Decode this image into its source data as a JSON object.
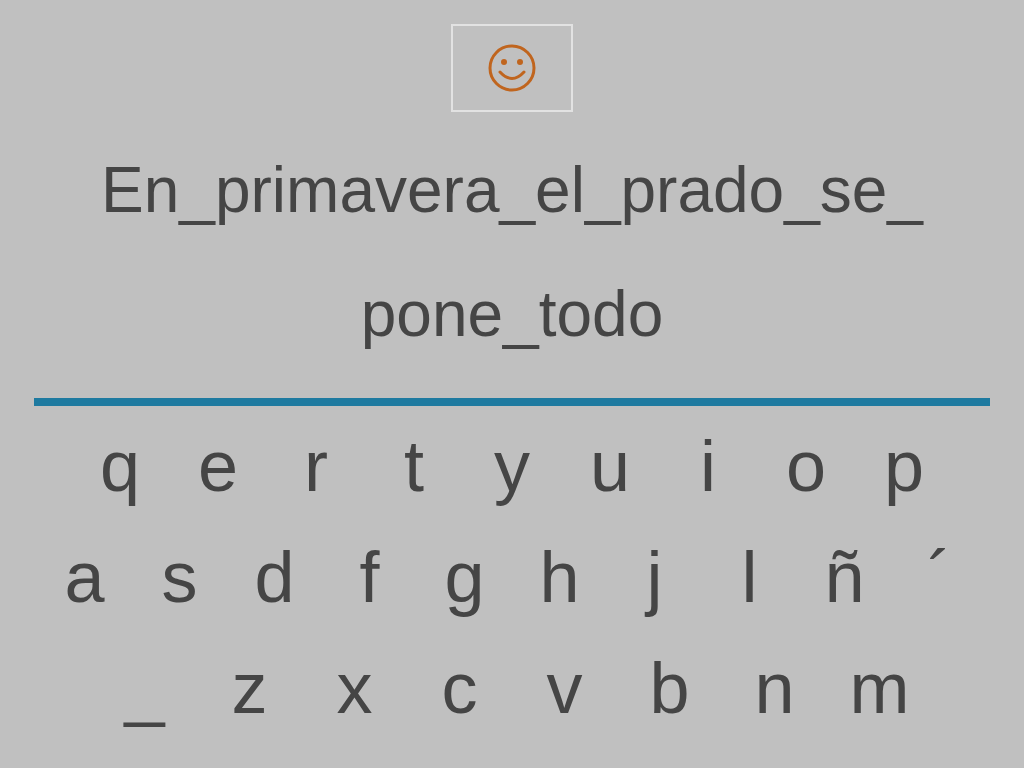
{
  "phrase_lines": [
    "En_primavera_el_prado_se_",
    "pone_todo"
  ],
  "keyboard": {
    "rows": [
      [
        "q",
        "e",
        "r",
        "t",
        "y",
        "u",
        "i",
        "o",
        "p"
      ],
      [
        "a",
        "s",
        "d",
        "f",
        "g",
        "h",
        "j",
        "l",
        "ñ",
        "´"
      ],
      [
        "_",
        "z",
        "x",
        "c",
        "v",
        "b",
        "n",
        "m"
      ]
    ]
  }
}
